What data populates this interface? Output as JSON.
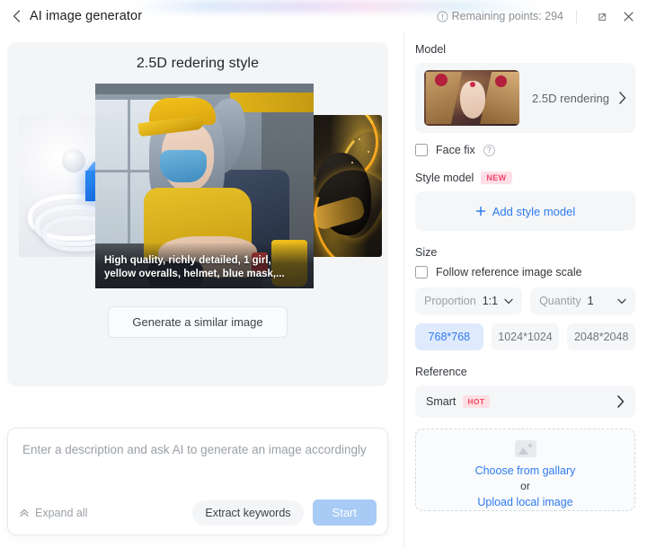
{
  "header": {
    "back_icon": "chevron-left-icon",
    "title": "AI image generator",
    "points_icon": "info-circle-icon",
    "points_label": "Remaining points: 294",
    "expand_icon": "external-link-icon",
    "close_icon": "close-icon"
  },
  "preview": {
    "title": "2.5D redering style",
    "caption": "High quality, richly detailed, 1 girl, yellow overalls, helmet, blue mask,...",
    "similar_button": "Generate a similar image"
  },
  "prompt": {
    "placeholder": "Enter a description and ask AI to generate an image accordingly",
    "value": "",
    "expand_all": "Expand all",
    "expand_icon": "chevron-up-double-icon",
    "extract_keywords": "Extract keywords",
    "start": "Start"
  },
  "panel": {
    "model": {
      "label": "Model",
      "name": "2.5D rendering",
      "chevron_icon": "chevron-right-icon",
      "face_fix_label": "Face fix",
      "face_fix_checked": false,
      "help_icon": "question-mark-icon"
    },
    "style_model": {
      "label": "Style model",
      "badge": "NEW",
      "add_label": "Add style model",
      "add_icon": "plus-icon"
    },
    "size": {
      "label": "Size",
      "follow_label": "Follow reference image scale",
      "follow_checked": false,
      "proportion_label": "Proportion",
      "proportion_value": "1:1",
      "quantity_label": "Quantity",
      "quantity_value": "1",
      "resolutions": [
        "768*768",
        "1024*1024",
        "2048*2048"
      ],
      "selected_resolution": "768*768",
      "chevron_icon": "chevron-down-icon"
    },
    "reference": {
      "label": "Reference",
      "smart_label": "Smart",
      "badge": "HOT",
      "chevron_icon": "chevron-right-icon",
      "placeholder_icon": "image-placeholder-icon",
      "gallery_link": "Choose from gallary",
      "or_text": "or",
      "upload_link": "Upload local image"
    }
  },
  "colors": {
    "accent_blue": "#2f7bf0",
    "selected_bg": "#dfeafd",
    "badge_pink": "#f5436b",
    "panel_grey": "#f5f6f8"
  }
}
